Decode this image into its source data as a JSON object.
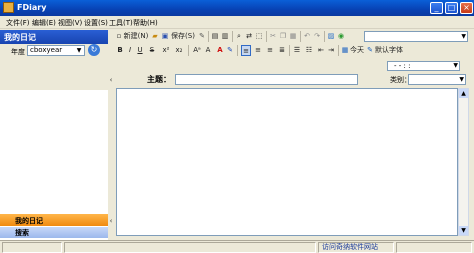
{
  "window": {
    "title": "FDiary"
  },
  "menu": [
    "文件(F)",
    "编辑(E)",
    "视图(V)",
    "设置(S)",
    "工具(T)",
    "帮助(H)"
  ],
  "left": {
    "header": "我的日记",
    "year_label": "年度",
    "year_value": "cboxyear",
    "nav_mydiary": "我的日记",
    "nav_search": "搜索"
  },
  "toolbar1": {
    "new_label": "新建(N)",
    "save_label": "保存(S)"
  },
  "toolbar2": {
    "today_label": "今天",
    "default_font_label": "默认字体"
  },
  "entry": {
    "date_value": "- -   :  :",
    "subject_label": "主题：",
    "category_label": "类别："
  },
  "status": {
    "link": "访问奇纳软件网站"
  }
}
